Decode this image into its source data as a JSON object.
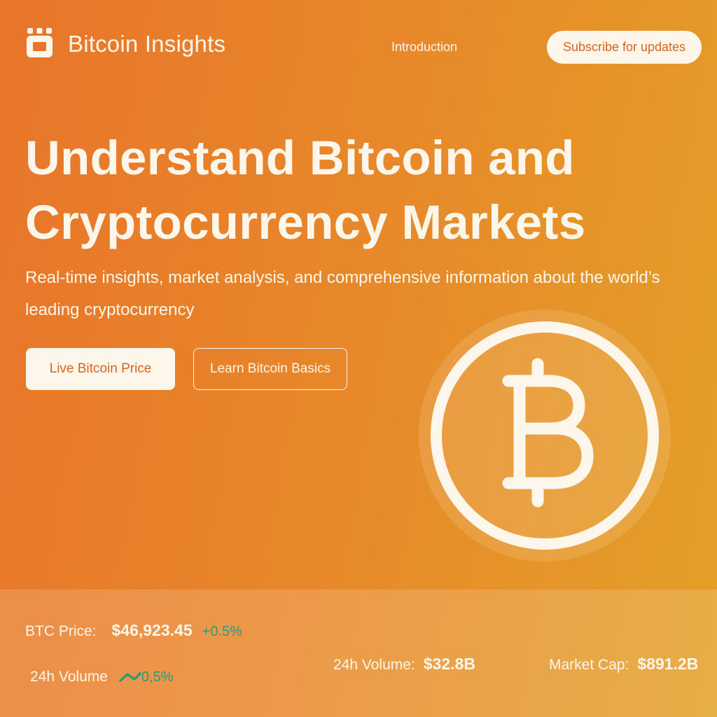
{
  "header": {
    "brand": "Bitcoin Insights",
    "nav": [
      "Introduction"
    ],
    "subscribe_label": "Subscribe for updates"
  },
  "hero": {
    "title_line1": "Understand Bitcoin and",
    "title_line2": "Cryptocurrency Markets",
    "subtitle": "Real-time insights, market analysis, and comprehensive information about the world’s leading cryptocurrency",
    "primary_button": "Live Bitcoin Price",
    "secondary_button": "Learn Bitcoin Basics"
  },
  "stats": {
    "price_label": "BTC Price:",
    "price_value": "$46,923.45",
    "price_change": "+0.5%",
    "volume_small_label": "24h Volume",
    "volume_small_change": "0,5%",
    "volume_label": "24h Volume:",
    "volume_value": "$32.8B",
    "market_cap_label": "Market Cap:",
    "market_cap_value": "$891.2B"
  },
  "icons": {
    "logo": "calendar-box-icon",
    "coin": "bitcoin-icon",
    "trend": "trend-up-icon"
  },
  "colors": {
    "accent": "#d9641d",
    "cream": "#fdf6ea",
    "positive": "#2d9a7c",
    "gradient_start": "#e8752a",
    "gradient_end": "#e3a028"
  }
}
